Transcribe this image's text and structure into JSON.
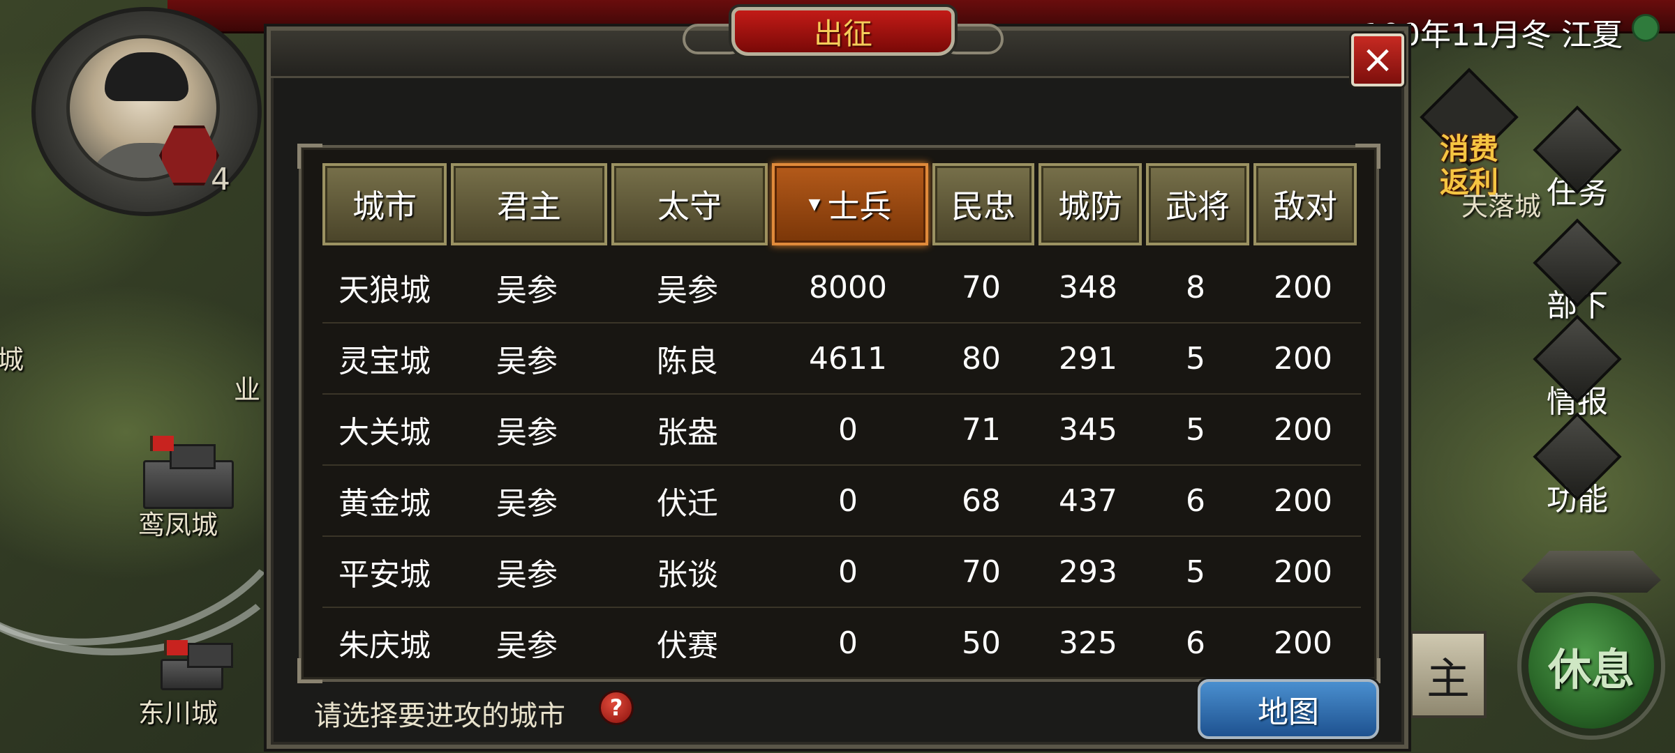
{
  "dialog": {
    "title": "出征",
    "close_label": "×",
    "hint": "请选择要进攻的城市",
    "help_label": "?",
    "map_button": "地图"
  },
  "table": {
    "sort_indicator": "▼",
    "headers": [
      "城市",
      "君主",
      "太守",
      "士兵",
      "民忠",
      "城防",
      "武将",
      "敌对"
    ],
    "sorted_column": "士兵",
    "rows": [
      [
        "天狼城",
        "吴参",
        "吴参",
        "8000",
        "70",
        "348",
        "8",
        "200"
      ],
      [
        "灵宝城",
        "吴参",
        "陈良",
        "4611",
        "80",
        "291",
        "5",
        "200"
      ],
      [
        "大关城",
        "吴参",
        "张盎",
        "0",
        "71",
        "345",
        "5",
        "200"
      ],
      [
        "黄金城",
        "吴参",
        "伏迁",
        "0",
        "68",
        "437",
        "6",
        "200"
      ],
      [
        "平安城",
        "吴参",
        "张谈",
        "0",
        "70",
        "293",
        "5",
        "200"
      ],
      [
        "朱庆城",
        "吴参",
        "伏赛",
        "0",
        "50",
        "325",
        "6",
        "200"
      ]
    ]
  },
  "hud": {
    "date": "100年11月冬 江夏",
    "level": "4",
    "promo": "消费返利",
    "menu": [
      "任务",
      "部下",
      "情报",
      "功能"
    ],
    "rest_button": "休息",
    "lord_tag": "主"
  },
  "map": {
    "cities": [
      "鸾凤城",
      "东川城",
      "城",
      "业",
      "天落城"
    ]
  },
  "colors": {
    "accent_title": "#f5cd5a",
    "header_gold": "#77704a",
    "sorted_header": "#b45a1a",
    "close_red": "#c72a22",
    "map_button_blue": "#4a8fcf",
    "rest_green": "#2c6a2a"
  }
}
